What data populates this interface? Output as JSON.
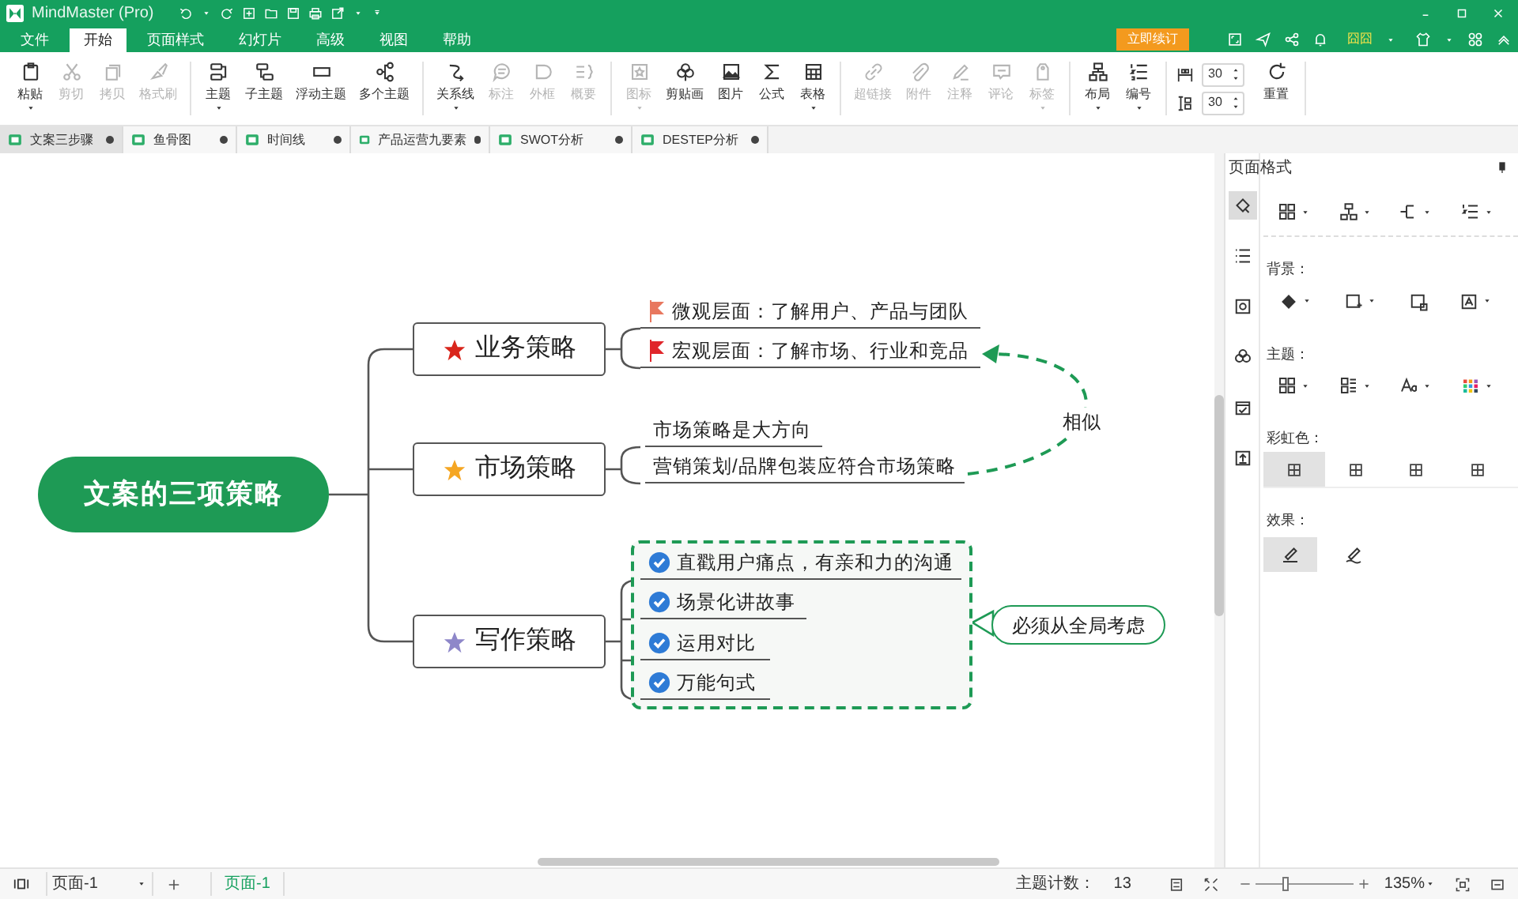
{
  "window": {
    "title": "MindMaster (Pro)"
  },
  "menu": [
    {
      "label": "文件",
      "selected": false
    },
    {
      "label": "开始",
      "selected": true
    },
    {
      "label": "页面样式",
      "selected": false
    },
    {
      "label": "幻灯片",
      "selected": false
    },
    {
      "label": "高级",
      "selected": false
    },
    {
      "label": "视图",
      "selected": false
    },
    {
      "label": "帮助",
      "selected": false
    }
  ],
  "renew_button": "立即续订",
  "user_name": "囧囧",
  "toolbar": {
    "groups": [
      [
        {
          "label": "粘贴",
          "disabled": false,
          "dropdown": true
        },
        {
          "label": "剪切",
          "disabled": true,
          "dropdown": false
        },
        {
          "label": "拷贝",
          "disabled": true,
          "dropdown": false
        },
        {
          "label": "格式刷",
          "disabled": true,
          "dropdown": false
        }
      ],
      [
        {
          "label": "主题",
          "disabled": false,
          "dropdown": true
        },
        {
          "label": "子主题",
          "disabled": false,
          "dropdown": false
        },
        {
          "label": "浮动主题",
          "disabled": false,
          "dropdown": false
        },
        {
          "label": "多个主题",
          "disabled": false,
          "dropdown": false
        }
      ],
      [
        {
          "label": "关系线",
          "disabled": false,
          "dropdown": true
        },
        {
          "label": "标注",
          "disabled": true,
          "dropdown": false
        },
        {
          "label": "外框",
          "disabled": true,
          "dropdown": false
        },
        {
          "label": "概要",
          "disabled": true,
          "dropdown": false
        }
      ],
      [
        {
          "label": "图标",
          "disabled": true,
          "dropdown": true
        },
        {
          "label": "剪贴画",
          "disabled": false,
          "dropdown": false
        },
        {
          "label": "图片",
          "disabled": false,
          "dropdown": false
        },
        {
          "label": "公式",
          "disabled": false,
          "dropdown": false
        },
        {
          "label": "表格",
          "disabled": false,
          "dropdown": true
        }
      ],
      [
        {
          "label": "超链接",
          "disabled": true,
          "dropdown": false
        },
        {
          "label": "附件",
          "disabled": true,
          "dropdown": false
        },
        {
          "label": "注释",
          "disabled": true,
          "dropdown": false
        },
        {
          "label": "评论",
          "disabled": true,
          "dropdown": false
        },
        {
          "label": "标签",
          "disabled": true,
          "dropdown": true
        }
      ],
      [
        {
          "label": "布局",
          "disabled": false,
          "dropdown": true
        },
        {
          "label": "编号",
          "disabled": false,
          "dropdown": true
        }
      ]
    ],
    "spacing_fields": [
      "30",
      "30"
    ],
    "reset_button": "重置"
  },
  "doc_tabs": [
    {
      "label": "文案三步骤",
      "selected": true
    },
    {
      "label": "鱼骨图",
      "selected": false
    },
    {
      "label": "时间线",
      "selected": false
    },
    {
      "label": "产品运营九要素",
      "selected": false
    },
    {
      "label": "SWOT分析",
      "selected": false
    },
    {
      "label": "DESTEP分析",
      "selected": false
    }
  ],
  "mind_map": {
    "central": "文案的三项策略",
    "branches": [
      {
        "label": "业务策略",
        "color": "#d9261c",
        "children": [
          {
            "label": "微观层面：了解用户、产品与团队",
            "kind": "flag",
            "color": "#e8775e"
          },
          {
            "label": "宏观层面：了解市场、行业和竞品",
            "kind": "flag",
            "color": "#e0262b"
          }
        ]
      },
      {
        "label": "市场策略",
        "color": "#f5a623",
        "children": [
          {
            "label": "市场策略是大方向",
            "kind": "plain"
          },
          {
            "label": "营销策划/品牌包装应符合市场策略",
            "kind": "plain"
          }
        ]
      },
      {
        "label": "写作策略",
        "color": "#8e87c9",
        "children": [
          {
            "label": "直戳用户痛点，有亲和力的沟通",
            "kind": "check"
          },
          {
            "label": "场景化讲故事",
            "kind": "check"
          },
          {
            "label": "运用对比",
            "kind": "check"
          },
          {
            "label": "万能句式",
            "kind": "check"
          }
        ]
      }
    ],
    "relationship_label": "相似",
    "boundary_callout": "必须从全局考虑"
  },
  "side_panel": {
    "title": "页面格式",
    "tabs": [
      {
        "selected": true
      },
      {
        "selected": false
      },
      {
        "selected": false
      },
      {
        "selected": false
      },
      {
        "selected": false
      },
      {
        "selected": false
      }
    ],
    "background_label": "背景：",
    "theme_label": "主题：",
    "rainbow": {
      "label": "彩虹色：",
      "options": [
        {
          "selected": true
        },
        {
          "selected": false
        },
        {
          "selected": false
        },
        {
          "selected": false
        }
      ]
    },
    "effects": {
      "label": "效果：",
      "options": [
        {
          "selected": true
        },
        {
          "selected": false
        }
      ]
    }
  },
  "status_bar": {
    "page_select": "页面-1",
    "page_tab": "页面-1",
    "topic_count_label": "主题计数：",
    "topic_count": "13",
    "zoom": {
      "level": 0.3
    },
    "zoom_value": "135%"
  }
}
